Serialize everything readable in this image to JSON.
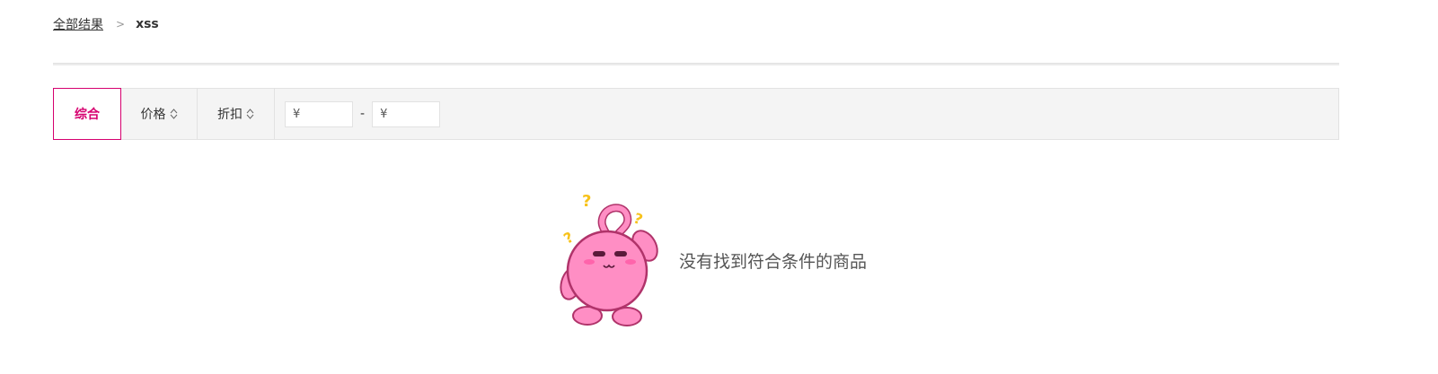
{
  "breadcrumb": {
    "root": "全部结果",
    "separator": ">",
    "current": "xss"
  },
  "sort": {
    "tabs": [
      {
        "label": "综合",
        "active": true
      },
      {
        "label": "价格",
        "icon": "sort-updown-icon"
      },
      {
        "label": "折扣",
        "icon": "sort-updown-icon"
      }
    ]
  },
  "price_range": {
    "min_placeholder": "¥",
    "max_placeholder": "¥",
    "separator": "-"
  },
  "empty_state": {
    "message": "没有找到符合条件的商品",
    "illustration": "pink-bunny-confused-icon"
  },
  "colors": {
    "accent": "#d6006f",
    "bar_bg": "#f4f4f4",
    "border": "#e2e2e2",
    "mascot_pink": "#ff8ec4",
    "question_mark": "#f7c21a"
  }
}
